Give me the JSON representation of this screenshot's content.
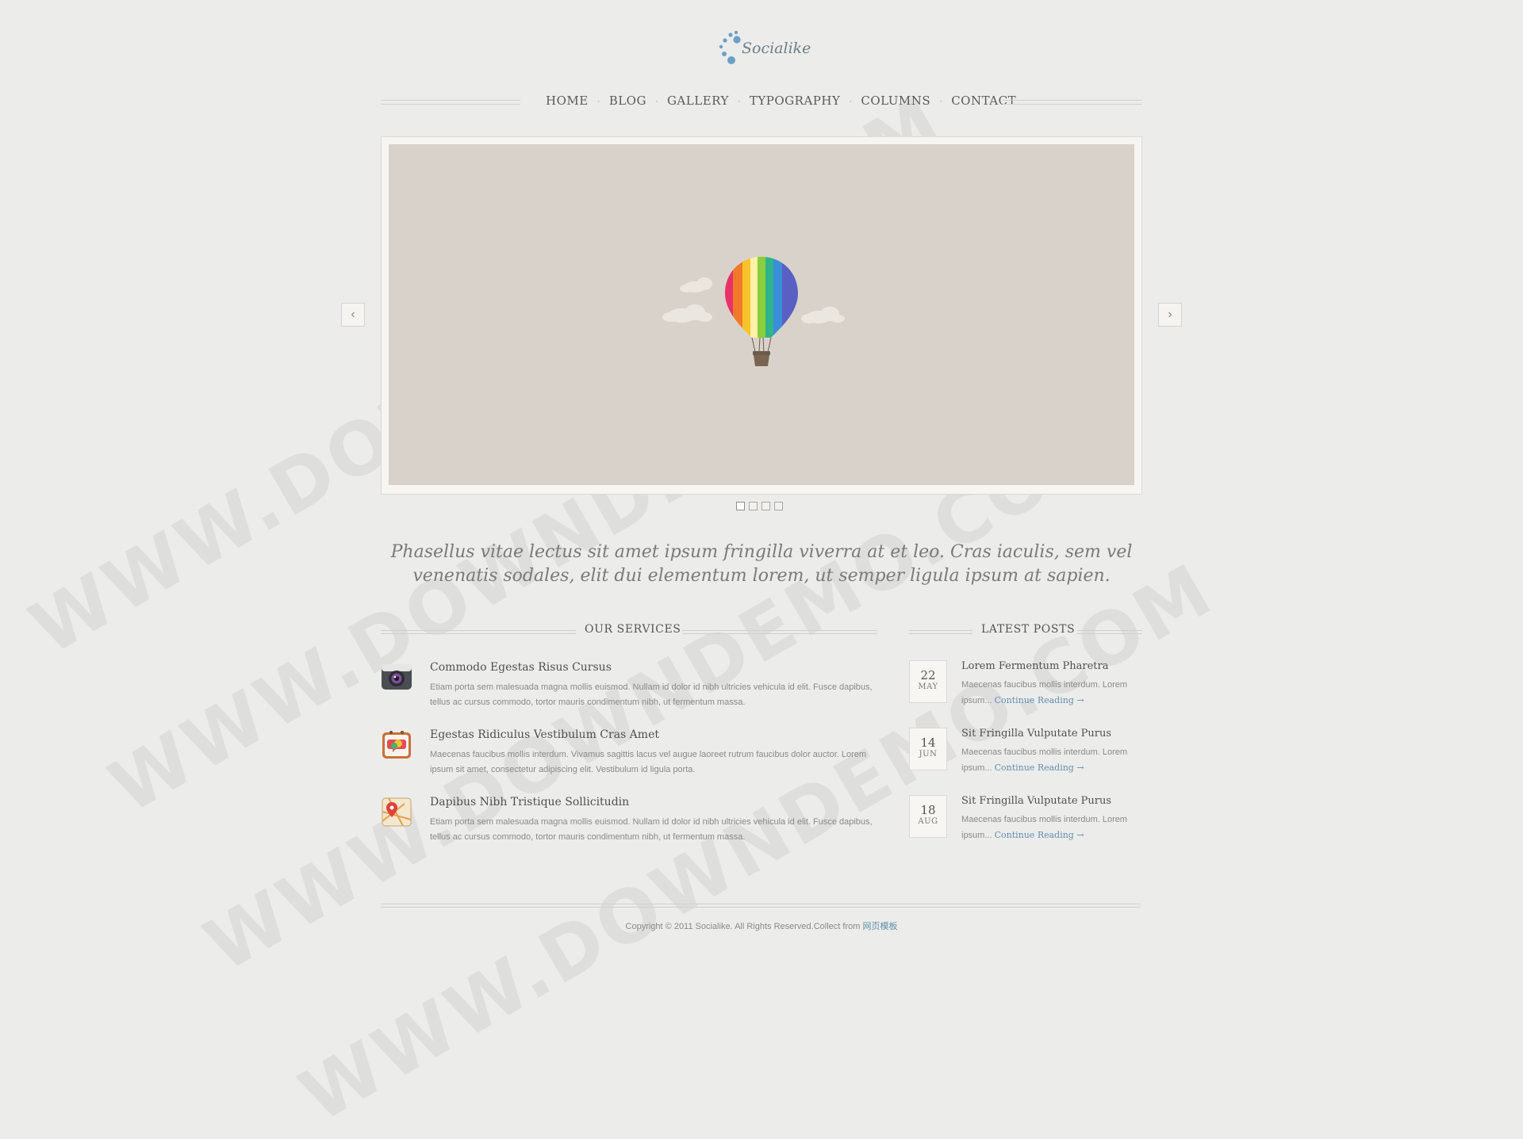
{
  "brand": {
    "name": "Socialike",
    "logo_icon": "dots-logo-icon"
  },
  "nav": {
    "items": [
      {
        "label": "HOME"
      },
      {
        "label": "BLOG"
      },
      {
        "label": "GALLERY"
      },
      {
        "label": "TYPOGRAPHY"
      },
      {
        "label": "COLUMNS"
      },
      {
        "label": "CONTACT"
      }
    ],
    "separator": "·"
  },
  "slider": {
    "slide_image": "hot-air-balloon-illustration",
    "slide_count": 4,
    "active_index": 0,
    "prev_icon": "chevron-left-icon",
    "next_icon": "chevron-right-icon",
    "background": "#d9d2cb"
  },
  "tagline": "Phasellus vitae lectus sit amet ipsum fringilla viverra at et leo. Cras iaculis, sem vel venenatis sodales, elit dui elementum lorem, ut semper ligula ipsum at sapien.",
  "services": {
    "heading": "OUR SERVICES",
    "items": [
      {
        "icon": "camera-icon",
        "title": "Commodo Egestas Risus Cursus",
        "text": "Etiam porta sem malesuada magna mollis euismod. Nullam id dolor id nibh ultricies vehicula id elit. Fusce dapibus, tellus ac cursus commodo, tortor mauris condimentum nibh, ut fermentum massa."
      },
      {
        "icon": "chat-calendar-icon",
        "title": "Egestas Ridiculus Vestibulum Cras Amet",
        "text": "Maecenas faucibus mollis interdum. Vivamus sagittis lacus vel augue laoreet rutrum faucibus dolor auctor. Lorem ipsum sit amet, consectetur adipiscing elit. Vestibulum id ligula porta."
      },
      {
        "icon": "map-pin-icon",
        "title": "Dapibus Nibh Tristique Sollicitudin",
        "text": "Etiam porta sem malesuada magna mollis euismod. Nullam id dolor id nibh ultricies vehicula id elit. Fusce dapibus, tellus ac cursus commodo, tortor mauris condimentum nibh, ut fermentum massa."
      }
    ]
  },
  "posts": {
    "heading": "LATEST POSTS",
    "continue_label": "Continue Reading →",
    "items": [
      {
        "day": "22",
        "month": "MAY",
        "title": "Lorem Fermentum Pharetra",
        "text": "Maecenas faucibus mollis interdum. Lorem ipsum..."
      },
      {
        "day": "14",
        "month": "JUN",
        "title": "Sit Fringilla Vulputate Purus",
        "text": "Maecenas faucibus mollis interdum. Lorem ipsum..."
      },
      {
        "day": "18",
        "month": "AUG",
        "title": "Sit Fringilla Vulputate Purus",
        "text": "Maecenas faucibus mollis interdum. Lorem ipsum..."
      }
    ]
  },
  "footer": {
    "text": "Copyright © 2011 Socialike. All Rights Reserved.Collect from ",
    "link": "网页模板"
  },
  "watermark": "WWW.DOWNDEMO.COM",
  "colors": {
    "page_bg": "#ececea",
    "link": "#5f8fb0",
    "logo": "#6aa0c8"
  }
}
